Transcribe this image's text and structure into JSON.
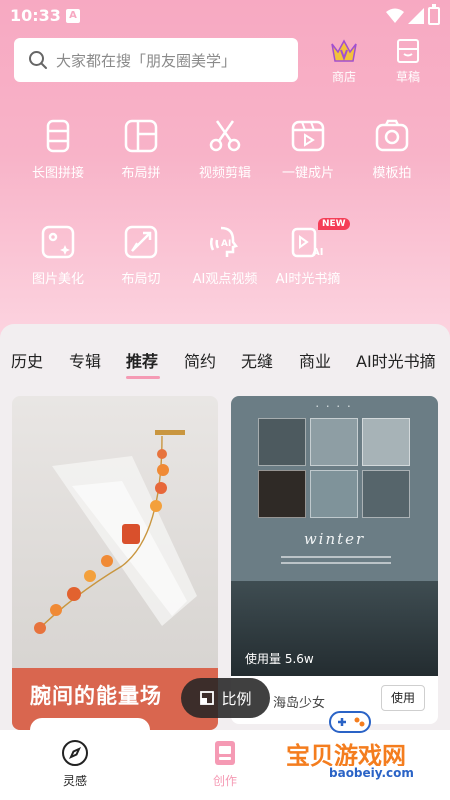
{
  "status": {
    "time": "10:33"
  },
  "search": {
    "placeholder": "大家都在搜「朋友圈美学」"
  },
  "top_actions": {
    "shop": "商店",
    "draft": "草稿"
  },
  "tools": [
    {
      "label": "长图拼接",
      "icon": "long-image-stitch-icon"
    },
    {
      "label": "布局拼",
      "icon": "layout-collage-icon"
    },
    {
      "label": "视频剪辑",
      "icon": "scissors-icon"
    },
    {
      "label": "一键成片",
      "icon": "one-click-video-icon"
    },
    {
      "label": "模板拍",
      "icon": "camera-icon"
    },
    {
      "label": "图片美化",
      "icon": "photo-beautify-icon"
    },
    {
      "label": "布局切",
      "icon": "layout-cut-icon"
    },
    {
      "label": "AI观点视频",
      "icon": "ai-viewpoint-video-icon"
    },
    {
      "label": "AI时光书摘",
      "icon": "ai-book-excerpt-icon",
      "badge": "NEW"
    }
  ],
  "tabs": [
    "历史",
    "专辑",
    "推荐",
    "简约",
    "无缝",
    "商业",
    "AI时光书摘"
  ],
  "active_tab": "推荐",
  "cards": {
    "left": {
      "caption": "腕间的能量场"
    },
    "right": {
      "usage": "使用量 5.6w",
      "author": "海岛少女",
      "use_label": "使用",
      "poster_word": "winter"
    }
  },
  "ratio_button": "比例",
  "nav": {
    "inspire": "灵感",
    "create": "创作"
  },
  "watermark": {
    "text": "宝贝游戏网",
    "url": "baobeiy.com"
  },
  "colors": {
    "accent_pink": "#f59ab4",
    "header_pink": "#f7a9c2",
    "badge_red": "#f53e57",
    "caption_orange": "#d9664f"
  }
}
